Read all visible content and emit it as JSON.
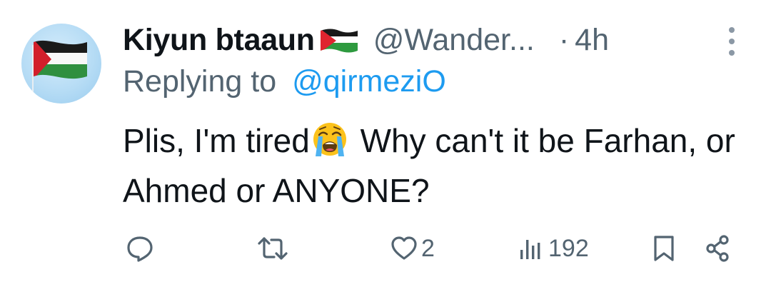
{
  "tweet": {
    "display_name": "Kiyun btaaun",
    "handle": "@Wander...",
    "dot": "·",
    "time": "4h",
    "replying_prefix": "Replying to",
    "replying_mention": "@qirmeziO",
    "text_part1": "Plis, I'm tired",
    "text_part2": " Why can't it be Farhan, or Ahmed or ANYONE?",
    "emoji": "loudly-crying-face-emoji",
    "name_emoji": "palestine-flag-emoji"
  },
  "actions": {
    "reply_icon": "reply-icon",
    "repost_icon": "repost-icon",
    "like_icon": "heart-icon",
    "like_count": "2",
    "views_icon": "views-icon",
    "views_count": "192",
    "bookmark_icon": "bookmark-icon",
    "share_icon": "share-icon"
  },
  "colors": {
    "text_primary": "#0f1419",
    "text_secondary": "#536471",
    "link": "#1d9bf0",
    "icon": "#536471"
  }
}
